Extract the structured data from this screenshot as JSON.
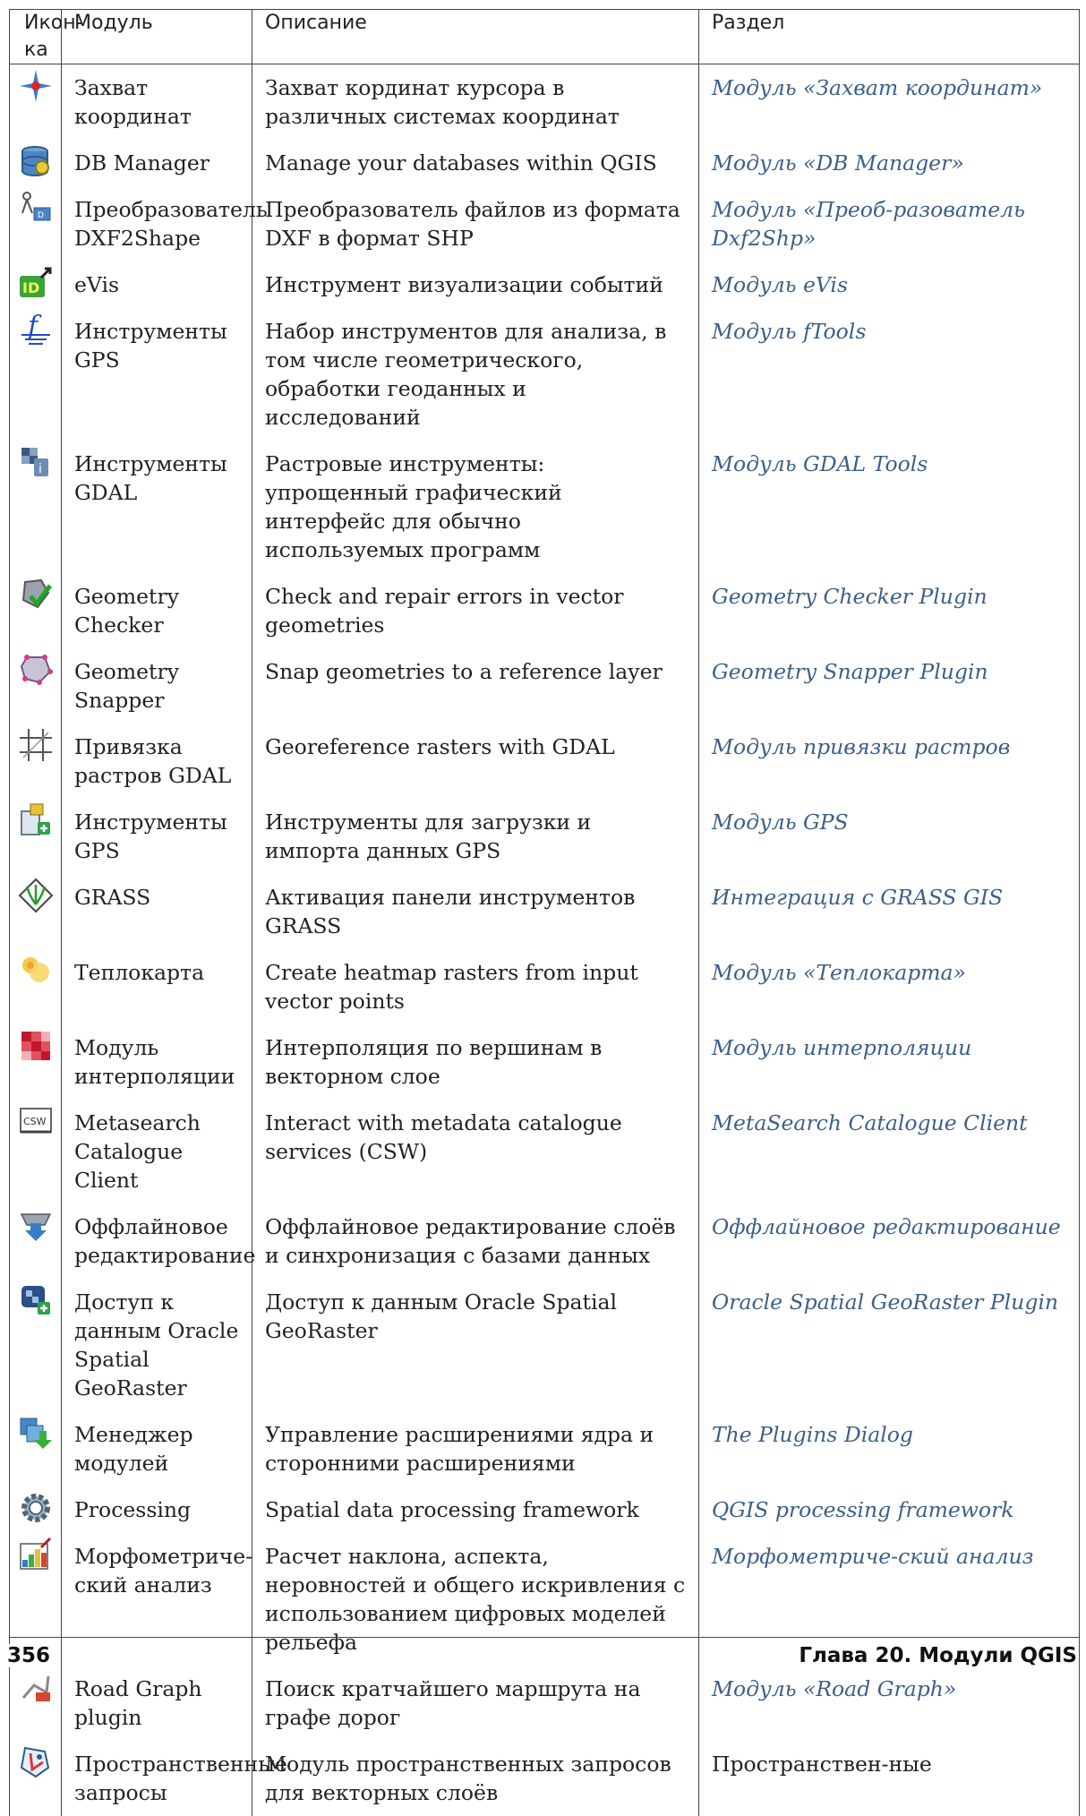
{
  "table": {
    "headers": [
      "Икон-ка",
      "Модуль",
      "Описание",
      "Раздел"
    ],
    "rows": [
      {
        "icon": "crosshair-icon",
        "module": "Захват координат",
        "description": "Захват кординат курсора в различных системах координат",
        "section": "Модуль «Захват координат»"
      },
      {
        "icon": "database-icon",
        "module": "DB Manager",
        "description": "Manage your databases within QGIS",
        "section": "Модуль «DB Manager»"
      },
      {
        "icon": "dxf-converter-icon",
        "module": "Преобразователь DXF2Shape",
        "description": "Преобразователь файлов из формата DXF в формат SHP",
        "section": "Модуль «Преоб-разователь Dxf2Shp»"
      },
      {
        "icon": "evis-icon",
        "module": "eVis",
        "description": "Инструмент визуализации событий",
        "section": "Модуль eVis"
      },
      {
        "icon": "ftools-icon",
        "module": "Инструменты GPS",
        "description": "Набор инструментов для анализа, в том числе геометрического, обработки геоданных и исследований",
        "section": "Модуль fTools"
      },
      {
        "icon": "gdal-tools-icon",
        "module": "Инструменты GDAL",
        "description": "Растровые инструменты: упрощенный графический интерфейс для обычно используемых программ",
        "section": "Модуль GDAL Tools"
      },
      {
        "icon": "geometry-checker-icon",
        "module": "Geometry Checker",
        "description": "Check and repair errors in vector geometries",
        "section": "Geometry Checker Plugin"
      },
      {
        "icon": "geometry-snapper-icon",
        "module": "Geometry Snapper",
        "description": "Snap geometries to a reference layer",
        "section": "Geometry Snapper Plugin"
      },
      {
        "icon": "georeferencer-icon",
        "module": "Привязка растров GDAL",
        "description": "Georeference rasters with GDAL",
        "section": "Модуль привязки растров"
      },
      {
        "icon": "gps-tools-icon",
        "module": "Инструменты GPS",
        "description": "Инструменты для загрузки и импорта данных GPS",
        "section": "Модуль GPS"
      },
      {
        "icon": "grass-icon",
        "module": "GRASS",
        "description": "Активация панели инструментов GRASS",
        "section": "Интеграция с GRASS GIS"
      },
      {
        "icon": "heatmap-icon",
        "module": "Теплокарта",
        "description": "Create heatmap rasters from input vector points",
        "section": "Модуль «Теплокарта»"
      },
      {
        "icon": "interpolation-icon",
        "module": "Модуль интерполяции",
        "description": "Интерполяция по вершинам в векторном слое",
        "section": "Модуль интерполяции"
      },
      {
        "icon": "csw-icon",
        "module": "Metasearch Catalogue Client",
        "description": "Interact with metadata catalogue services (CSW)",
        "section": "MetaSearch Catalogue Client"
      },
      {
        "icon": "offline-editing-icon",
        "module": "Оффлайновое редактирование",
        "description": "Оффлайновое редактирование слоёв и синхронизация с базами данных",
        "section": "Оффлайновое редактирование"
      },
      {
        "icon": "oracle-georaster-icon",
        "module": "Доступ к данным Oracle Spatial GeoRaster",
        "description": "Доступ к данным Oracle Spatial GeoRaster",
        "section": "Oracle Spatial GeoRaster Plugin"
      },
      {
        "icon": "plugin-manager-icon",
        "module": "Менеджер модулей",
        "description": "Управление расширениями ядра и сторонними расширениями",
        "section": "The Plugins Dialog"
      },
      {
        "icon": "processing-gear-icon",
        "module": "Processing",
        "description": "Spatial data processing framework",
        "section": "QGIS processing framework"
      },
      {
        "icon": "terrain-analysis-icon",
        "module": "Морфометриче-ский анализ",
        "description": "Расчет наклона, аспекта, неровностей и общего искривления с использованием цифровых моделей рельефа",
        "section": "Морфометриче-ский анализ"
      },
      {
        "icon": "road-graph-icon",
        "module": "Road Graph plugin",
        "description": "Поиск кратчайшего маршрута на графе дорог",
        "section": "Модуль «Road Graph»"
      },
      {
        "icon": "spatial-query-icon",
        "module": "Пространственные запросы",
        "description": "Модуль пространственных запросов для векторных слоёв",
        "section": "Пространствен-ные"
      }
    ]
  },
  "footer": {
    "page_number": "356",
    "chapter": "Глава 20. Модули QGIS"
  }
}
